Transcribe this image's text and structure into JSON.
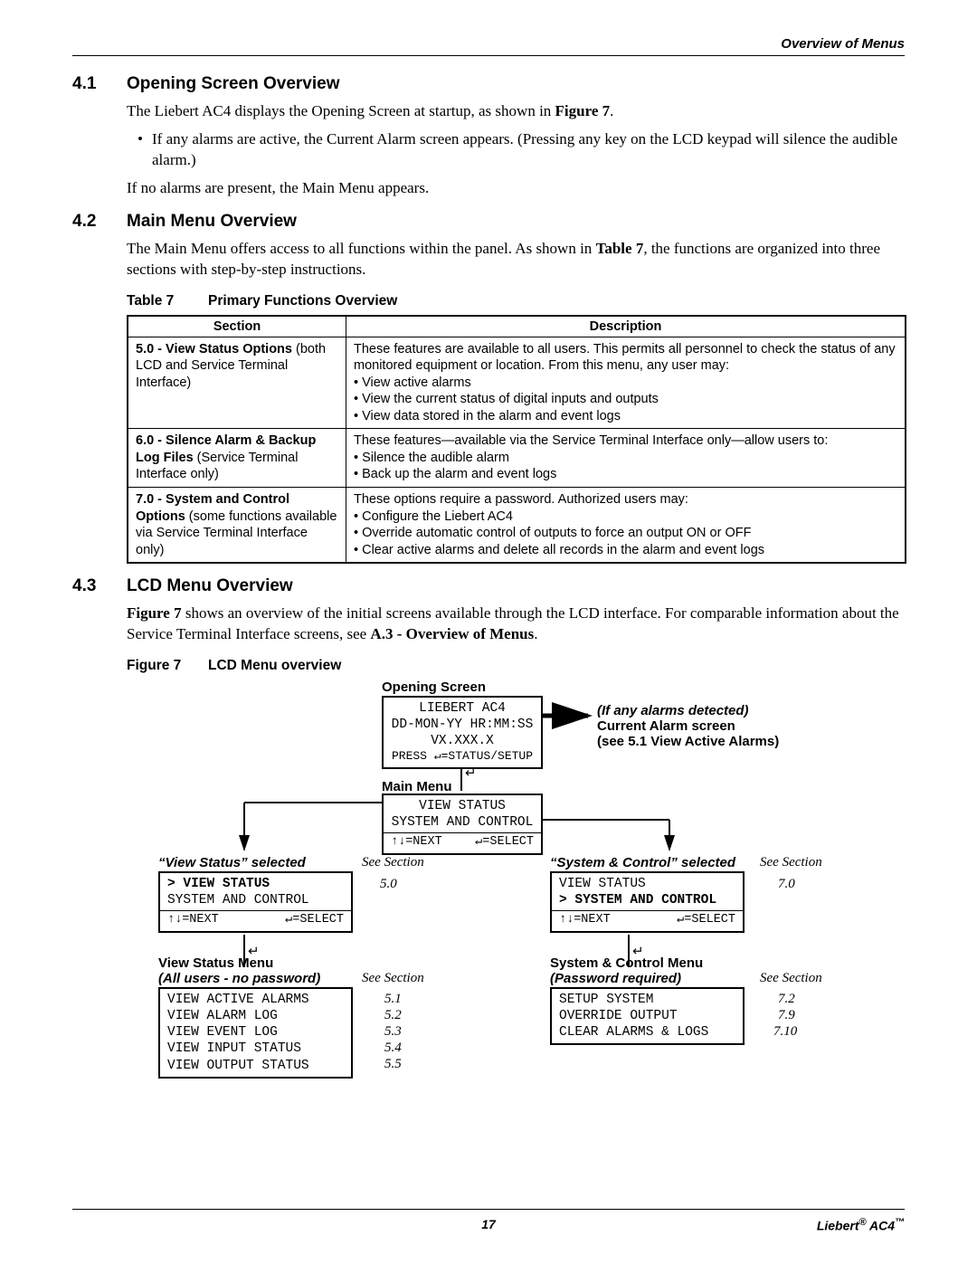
{
  "running_head": "Overview of Menus",
  "section_4_1": {
    "num": "4.1",
    "title": "Opening Screen Overview",
    "para1_pre": "The Liebert AC4 displays the Opening Screen at startup, as shown in ",
    "para1_ref": "Figure 7",
    "para1_post": ".",
    "bullet": "If any alarms are active, the Current Alarm screen appears. (Pressing any key on the LCD keypad will silence the audible alarm.)",
    "para2": "If no alarms are present, the Main Menu appears."
  },
  "section_4_2": {
    "num": "4.2",
    "title": "Main Menu Overview",
    "para_pre": "The Main Menu offers access to all functions within the panel. As shown in ",
    "para_ref": "Table 7",
    "para_post": ", the functions are organized into three sections with step-by-step instructions."
  },
  "table7": {
    "caption_label": "Table 7",
    "caption_title": "Primary Functions Overview",
    "headers": {
      "col1": "Section",
      "col2": "Description"
    },
    "rows": [
      {
        "section_num": "5.0 - ",
        "section_bold": "View Status Options",
        "section_rest": " (both LCD and Service Terminal Interface)",
        "desc_intro": "These features are available to all users. This permits all personnel to check the status of any monitored equipment or location. From this menu, any user may:",
        "items": [
          "View active alarms",
          "View the current status of digital inputs and outputs",
          "View data stored in the alarm and event logs"
        ]
      },
      {
        "section_num": "6.0 - ",
        "section_bold": "Silence Alarm & Backup Log Files",
        "section_rest": " (Service Terminal Interface only)",
        "desc_intro": "These features—available via the Service Terminal Interface only—allow users to:",
        "items": [
          "Silence the audible alarm",
          "Back up the alarm and event logs"
        ]
      },
      {
        "section_num": "7.0 - ",
        "section_bold": "System and Control Options",
        "section_rest": " (some functions available via Service Terminal Interface only)",
        "desc_intro": "These options require a password. Authorized users may:",
        "items": [
          "Configure the Liebert AC4",
          "Override automatic control of outputs to force an output ON or OFF",
          "Clear active alarms and delete all records in the alarm and event logs"
        ]
      }
    ]
  },
  "section_4_3": {
    "num": "4.3",
    "title": "LCD Menu Overview",
    "para_pre": "Figure 7",
    "para_mid": " shows an overview of the initial screens available through the LCD interface. For comparable information about the Service Terminal Interface screens, see ",
    "para_ref2": "A.3 - Overview of Menus",
    "para_post": "."
  },
  "figure7": {
    "caption_label": "Figure 7",
    "caption_title": "LCD Menu overview",
    "labels": {
      "opening": "Opening Screen",
      "main_menu": "Main Menu",
      "alarm_note1": "(If any alarms detected)",
      "alarm_note2": "Current Alarm screen",
      "alarm_note3": "(see 5.1 View Active Alarms)",
      "vs_sel": "“View Status” selected",
      "sc_sel": "“System & Control” selected",
      "vs_menu": "View Status Menu",
      "vs_menu_sub": "(All users - no password)",
      "sc_menu": "System & Control Menu",
      "sc_menu_sub": "(Password required)",
      "see": "See Section"
    },
    "opening_box": {
      "l1": "LIEBERT AC4",
      "l2": "DD-MON-YY HR:MM:SS",
      "l3": "VX.XXX.X",
      "l4": "PRESS ↵=STATUS/SETUP"
    },
    "main_box": {
      "l1": "VIEW STATUS",
      "l2": "SYSTEM AND CONTROL",
      "nav_left": "↑↓=NEXT",
      "nav_right": "↵=SELECT"
    },
    "vs_box": {
      "l1": "> VIEW STATUS",
      "l2": "  SYSTEM AND CONTROL",
      "nav_left": "↑↓=NEXT",
      "nav_right": "↵=SELECT",
      "secref": "5.0"
    },
    "sc_box": {
      "l1": "  VIEW STATUS",
      "l2": "> SYSTEM AND CONTROL",
      "nav_left": "↑↓=NEXT",
      "nav_right": "↵=SELECT",
      "secref": "7.0"
    },
    "vs_menu_box": {
      "items": [
        "VIEW ACTIVE ALARMS",
        "VIEW ALARM LOG",
        "VIEW EVENT LOG",
        "VIEW INPUT STATUS",
        "VIEW OUTPUT STATUS"
      ],
      "refs": [
        "5.1",
        "5.2",
        "5.3",
        "5.4",
        "5.5"
      ]
    },
    "sc_menu_box": {
      "items": [
        "SETUP SYSTEM",
        "OVERRIDE OUTPUT",
        "CLEAR ALARMS & LOGS"
      ],
      "refs": [
        "7.2",
        "7.9",
        "7.10"
      ]
    }
  },
  "footer": {
    "page": "17",
    "product_pre": "Liebert",
    "product_post": " AC4"
  }
}
